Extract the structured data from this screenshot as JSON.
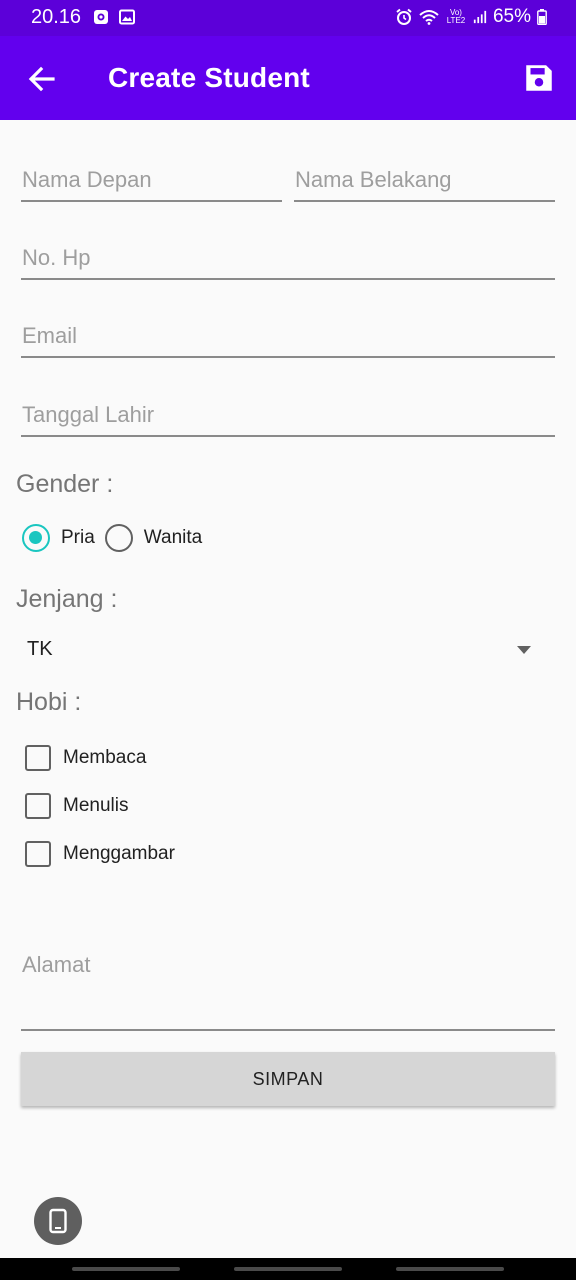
{
  "status_bar": {
    "time": "20.16",
    "left_icons": [
      "notification-icon",
      "gallery-icon"
    ],
    "right_icons": [
      "alarm-icon",
      "wifi-icon",
      "lte-icon",
      "signal-icon"
    ],
    "lte_label": "Vo) LTE2",
    "battery": "65%"
  },
  "app_bar": {
    "title": "Create Student",
    "back_icon": "arrow-back-icon",
    "save_icon": "save-icon"
  },
  "form": {
    "first_name": {
      "placeholder": "Nama Depan",
      "value": ""
    },
    "last_name": {
      "placeholder": "Nama Belakang",
      "value": ""
    },
    "phone": {
      "placeholder": "No. Hp",
      "value": ""
    },
    "email": {
      "placeholder": "Email",
      "value": ""
    },
    "birth_date": {
      "placeholder": "Tanggal Lahir",
      "value": ""
    },
    "gender_label": "Gender :",
    "gender_options": [
      {
        "label": "Pria",
        "checked": true
      },
      {
        "label": "Wanita",
        "checked": false
      }
    ],
    "level_label": "Jenjang :",
    "level_selected": "TK",
    "hobby_label": "Hobi :",
    "hobbies": [
      {
        "label": "Membaca",
        "checked": false
      },
      {
        "label": "Menulis",
        "checked": false
      },
      {
        "label": "Menggambar",
        "checked": false
      }
    ],
    "address": {
      "placeholder": "Alamat",
      "value": ""
    },
    "submit_label": "SIMPAN"
  },
  "colors": {
    "status_bar": "#5c00d9",
    "app_bar": "#6200ee",
    "accent": "#1ac6c0",
    "background": "#fafafa"
  }
}
